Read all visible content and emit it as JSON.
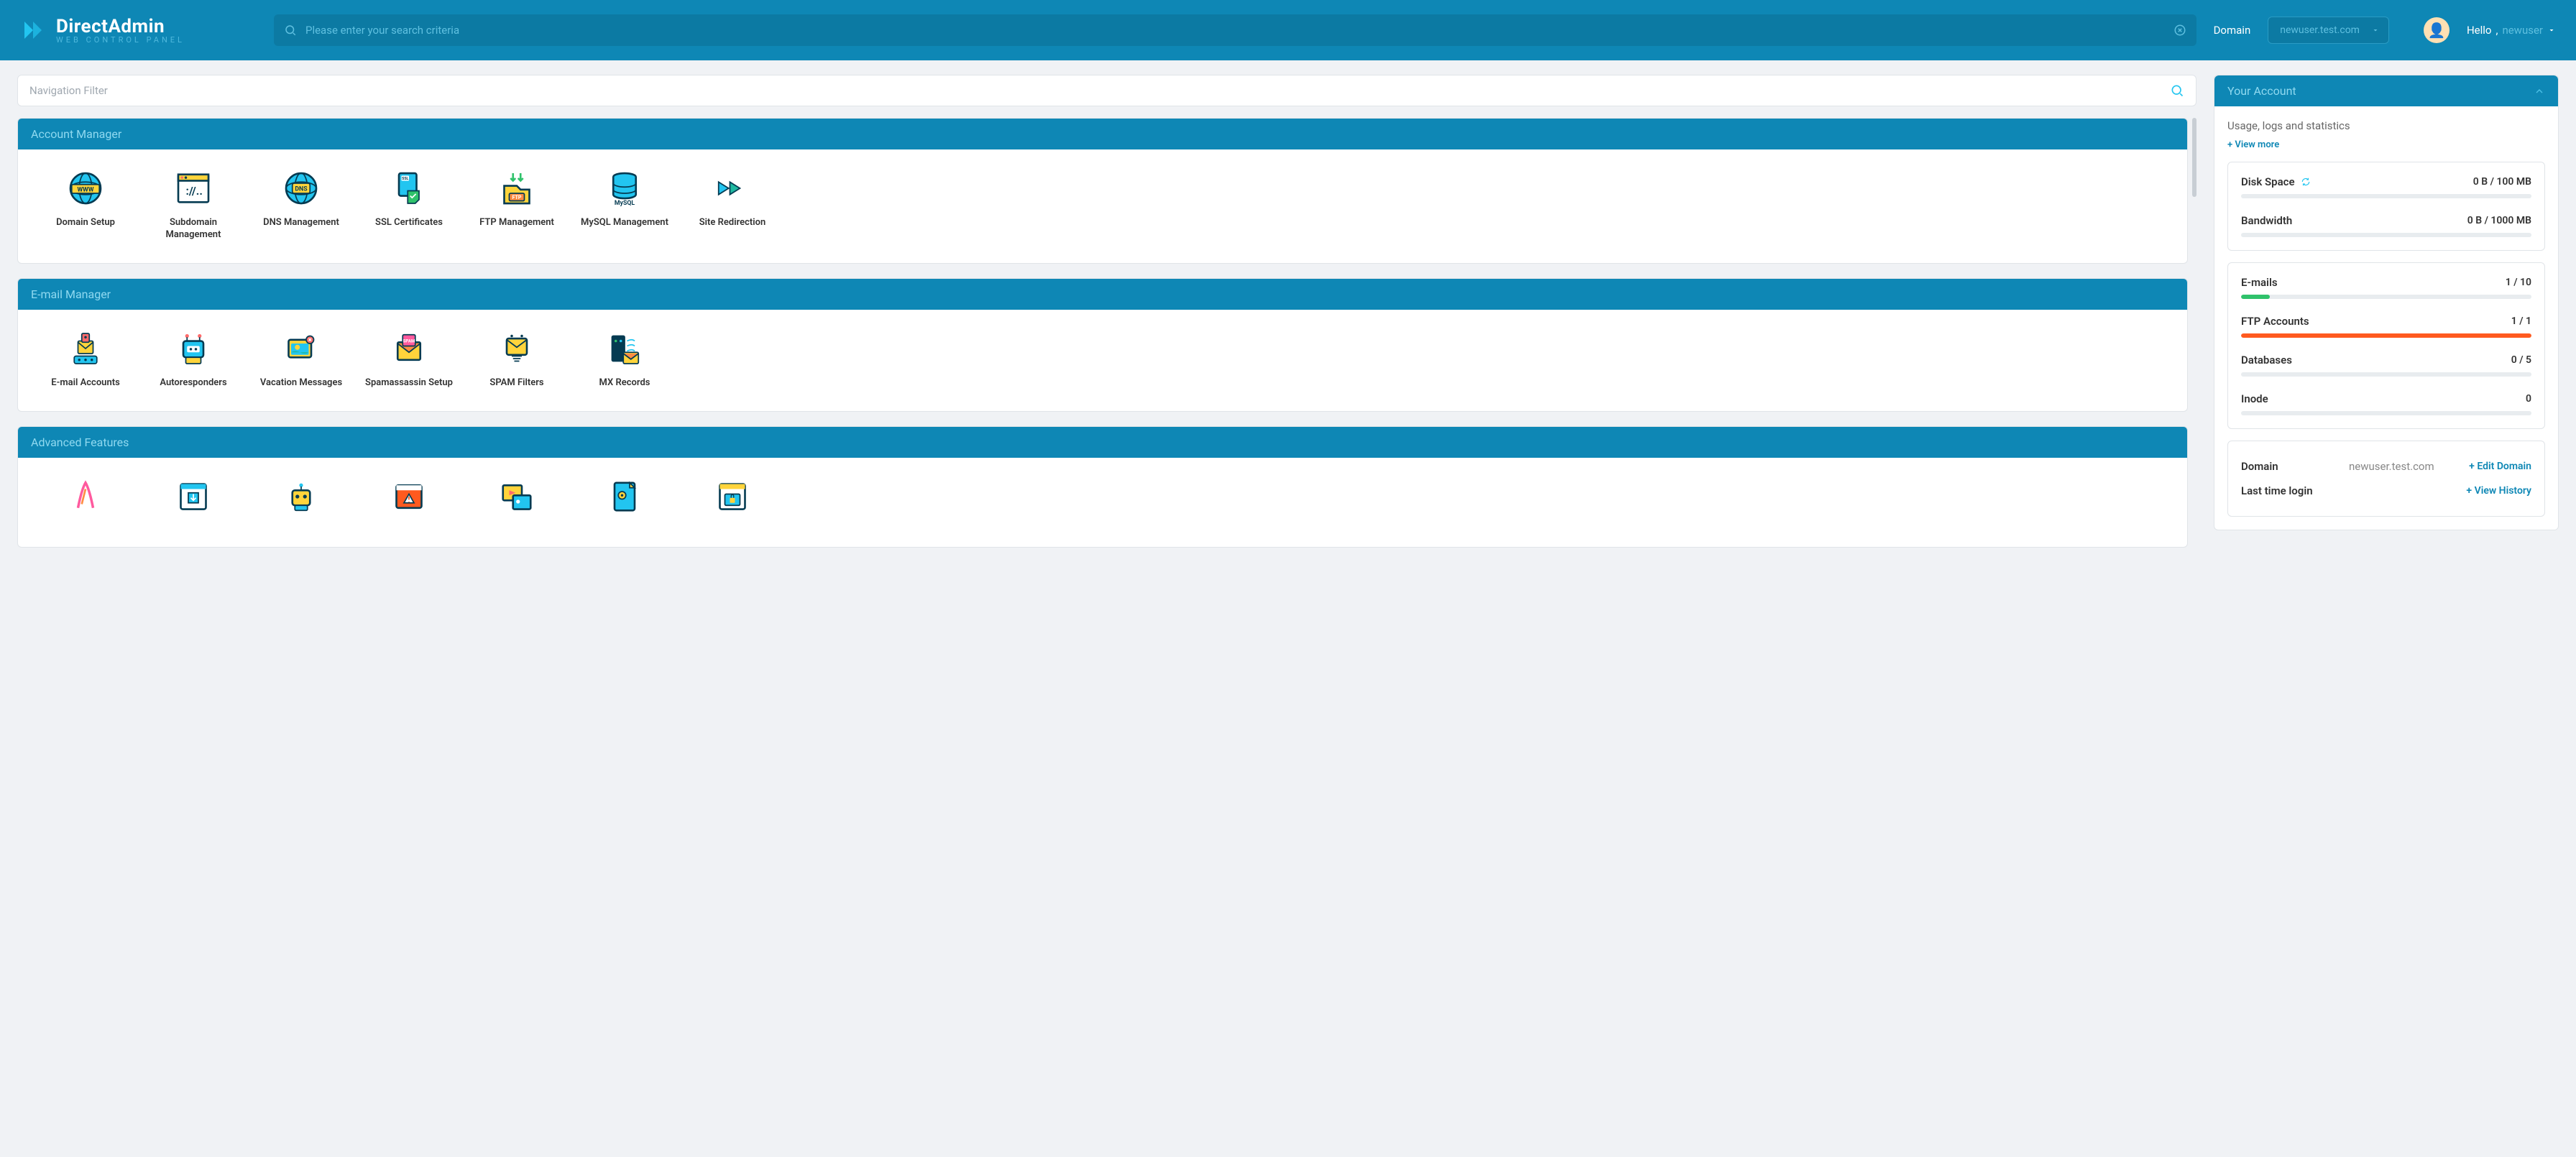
{
  "header": {
    "brand": "DirectAdmin",
    "sub": "web control panel",
    "search_placeholder": "Please enter your search criteria",
    "domain_label": "Domain",
    "domain_value": "newuser.test.com",
    "hello": "Hello",
    "username": "newuser"
  },
  "navfilter_placeholder": "Navigation Filter",
  "sections": [
    {
      "title": "Account Manager",
      "items": [
        {
          "label": "Domain Setup",
          "icon": "globe-www"
        },
        {
          "label": "Subdomain Management",
          "icon": "browser-slash"
        },
        {
          "label": "DNS Management",
          "icon": "globe-dns"
        },
        {
          "label": "SSL Certificates",
          "icon": "ssl-cert"
        },
        {
          "label": "FTP Management",
          "icon": "ftp-folder"
        },
        {
          "label": "MySQL Management",
          "icon": "mysql-db"
        },
        {
          "label": "Site Redirection",
          "icon": "redirect"
        }
      ]
    },
    {
      "title": "E-mail Manager",
      "items": [
        {
          "label": "E-mail Accounts",
          "icon": "mail-lock"
        },
        {
          "label": "Autoresponders",
          "icon": "robot"
        },
        {
          "label": "Vacation Messages",
          "icon": "beach"
        },
        {
          "label": "Spamassassin Setup",
          "icon": "spam-env"
        },
        {
          "label": "SPAM Filters",
          "icon": "spam-filter"
        },
        {
          "label": "MX Records",
          "icon": "mx-server"
        }
      ]
    },
    {
      "title": "Advanced Features",
      "items": [
        {
          "label": "",
          "icon": "apache"
        },
        {
          "label": "",
          "icon": "download"
        },
        {
          "label": "",
          "icon": "robot2"
        },
        {
          "label": "",
          "icon": "error-page"
        },
        {
          "label": "",
          "icon": "media"
        },
        {
          "label": "",
          "icon": "doc"
        },
        {
          "label": "",
          "icon": "secure-page"
        }
      ]
    }
  ],
  "account": {
    "title": "Your Account",
    "desc": "Usage, logs and statistics",
    "viewmore": "+ View more",
    "usage1": [
      {
        "name": "Disk Space",
        "value": "0 B / 100 MB",
        "pct": 0,
        "color": "#e8ecef",
        "refresh": true
      },
      {
        "name": "Bandwidth",
        "value": "0 B / 1000 MB",
        "pct": 0,
        "color": "#e8ecef"
      }
    ],
    "usage2": [
      {
        "name": "E-mails",
        "value": "1 / 10",
        "pct": 10,
        "color": "#2fc26b"
      },
      {
        "name": "FTP Accounts",
        "value": "1 / 1",
        "pct": 100,
        "color": "#ff5a1f"
      },
      {
        "name": "Databases",
        "value": "0 / 5",
        "pct": 0,
        "color": "#e8ecef"
      },
      {
        "name": "Inode",
        "value": "0",
        "pct": 0,
        "color": "#e8ecef"
      }
    ],
    "info": [
      {
        "key": "Domain",
        "val": "newuser.test.com",
        "action": "+ Edit Domain"
      },
      {
        "key": "Last time login",
        "val": "",
        "action": "+ View History"
      }
    ]
  }
}
